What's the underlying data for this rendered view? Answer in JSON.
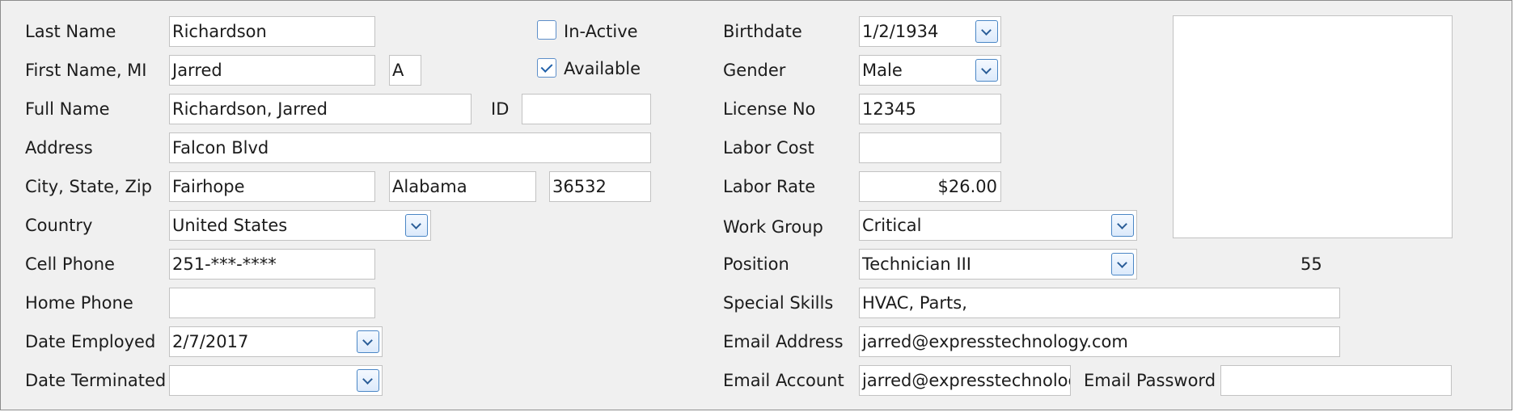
{
  "form": {
    "labels": {
      "last_name": "Last Name",
      "first_name_mi": "First Name, MI",
      "full_name": "Full Name",
      "id": "ID",
      "address": "Address",
      "city_state_zip": "City, State, Zip",
      "country": "Country",
      "cell_phone": "Cell Phone",
      "home_phone": "Home Phone",
      "date_employed": "Date Employed",
      "date_terminated": "Date Terminated",
      "in_active": "In-Active",
      "available": "Available",
      "birthdate": "Birthdate",
      "gender": "Gender",
      "license_no": "License No",
      "labor_cost": "Labor Cost",
      "labor_rate": "Labor Rate",
      "work_group": "Work Group",
      "position": "Position",
      "special_skills": "Special Skills",
      "email_address": "Email Address",
      "email_account": "Email Account",
      "email_password": "Email Password"
    },
    "values": {
      "last_name": "Richardson",
      "first_name": "Jarred",
      "middle_initial": "A",
      "full_name": "Richardson, Jarred",
      "id": "",
      "address": "Falcon Blvd",
      "city": "Fairhope",
      "state": "Alabama",
      "zip": "36532",
      "country": "United States",
      "cell_phone": "251-***-****",
      "home_phone": "",
      "date_employed": "2/7/2017",
      "date_terminated": "",
      "birthdate": "1/2/1934",
      "gender": "Male",
      "license_no": "12345",
      "labor_cost": "",
      "labor_rate": "$26.00",
      "work_group": "Critical",
      "position": "Technician III",
      "special_skills": "HVAC, Parts,",
      "email_address": "jarred@expresstechnology.com",
      "email_account": "jarred@expresstechnology",
      "email_password": "",
      "photo_number": "55"
    },
    "checkboxes": {
      "in_active": false,
      "available": true
    }
  }
}
